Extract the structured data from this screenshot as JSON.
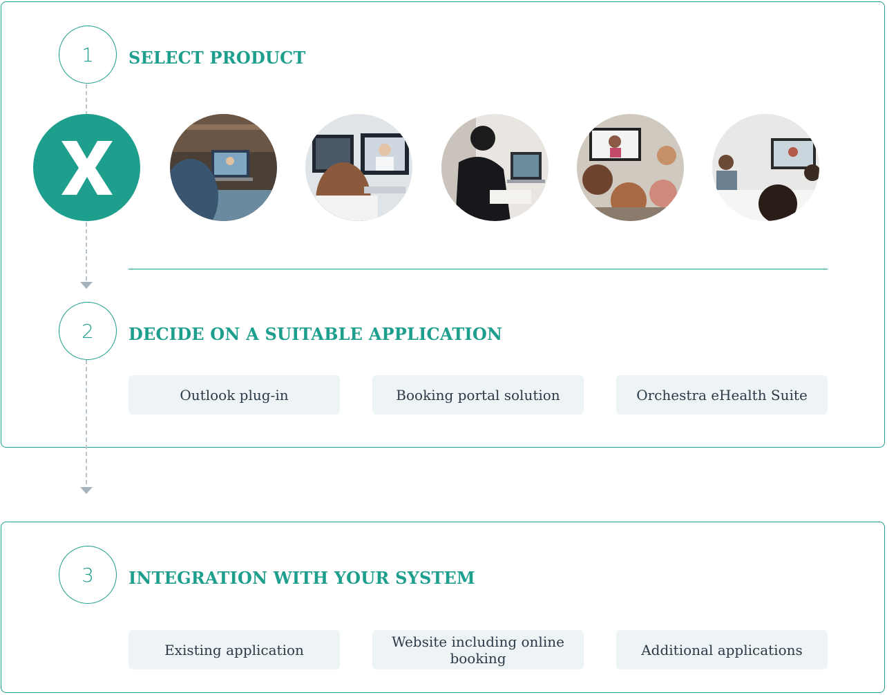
{
  "steps": [
    {
      "number": "1",
      "title": "SELECT PRODUCT"
    },
    {
      "number": "2",
      "title": "DECIDE ON A SUITABLE APPLICATION"
    },
    {
      "number": "3",
      "title": "INTEGRATION WITH YOUR SYSTEM"
    }
  ],
  "applications": [
    "Outlook plug-in",
    "Booking portal solution",
    "Orchestra eHealth Suite"
  ],
  "integrations": [
    "Existing application",
    "Website including online booking",
    "Additional applications"
  ],
  "colors": {
    "accent": "#1e9e8c",
    "option_bg": "#eef3f6",
    "dash": "#b9c4cc"
  },
  "icons": [
    "x-logo-icon"
  ]
}
